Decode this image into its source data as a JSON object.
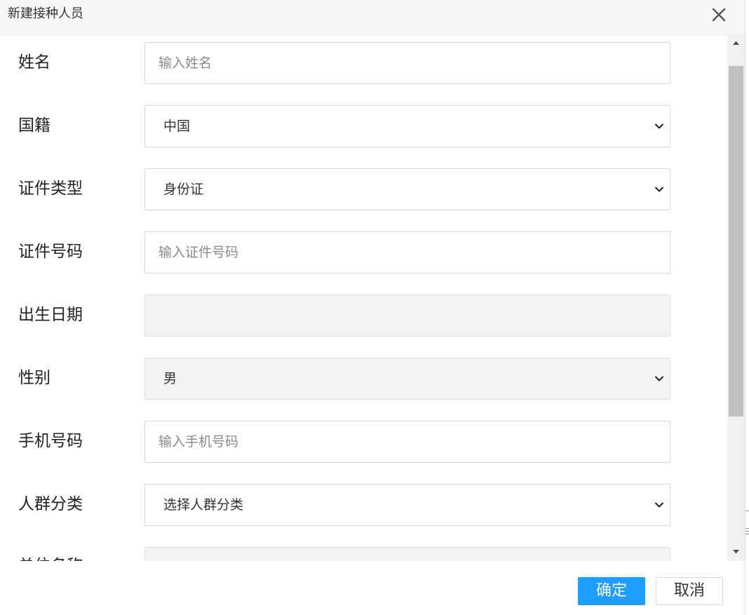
{
  "dialog": {
    "title": "新建接种人员"
  },
  "form": {
    "name": {
      "label": "姓名",
      "placeholder": "输入姓名",
      "value": ""
    },
    "nationality": {
      "label": "国籍",
      "value": "中国"
    },
    "id_type": {
      "label": "证件类型",
      "value": "身份证"
    },
    "id_number": {
      "label": "证件号码",
      "placeholder": "输入证件号码",
      "value": ""
    },
    "birth_date": {
      "label": "出生日期",
      "value": ""
    },
    "gender": {
      "label": "性别",
      "value": "男"
    },
    "phone": {
      "label": "手机号码",
      "placeholder": "输入手机号码",
      "value": ""
    },
    "population_category": {
      "label": "人群分类",
      "value": "选择人群分类"
    },
    "work_unit": {
      "label": "单位名称",
      "value": ""
    }
  },
  "footer": {
    "confirm_label": "确定",
    "cancel_label": "取消"
  },
  "icons": {
    "close": "close-icon",
    "chevron": "chevron-down-icon",
    "scroll_up": "triangle-up-icon",
    "scroll_down": "triangle-down-icon"
  },
  "colors": {
    "primary": "#1e9fff",
    "titlebar_bg": "#f7f7f7",
    "disabled_bg": "#f3f3f3",
    "scrollbar_track": "#f1f1f1",
    "scrollbar_thumb": "#c1c1c1"
  }
}
